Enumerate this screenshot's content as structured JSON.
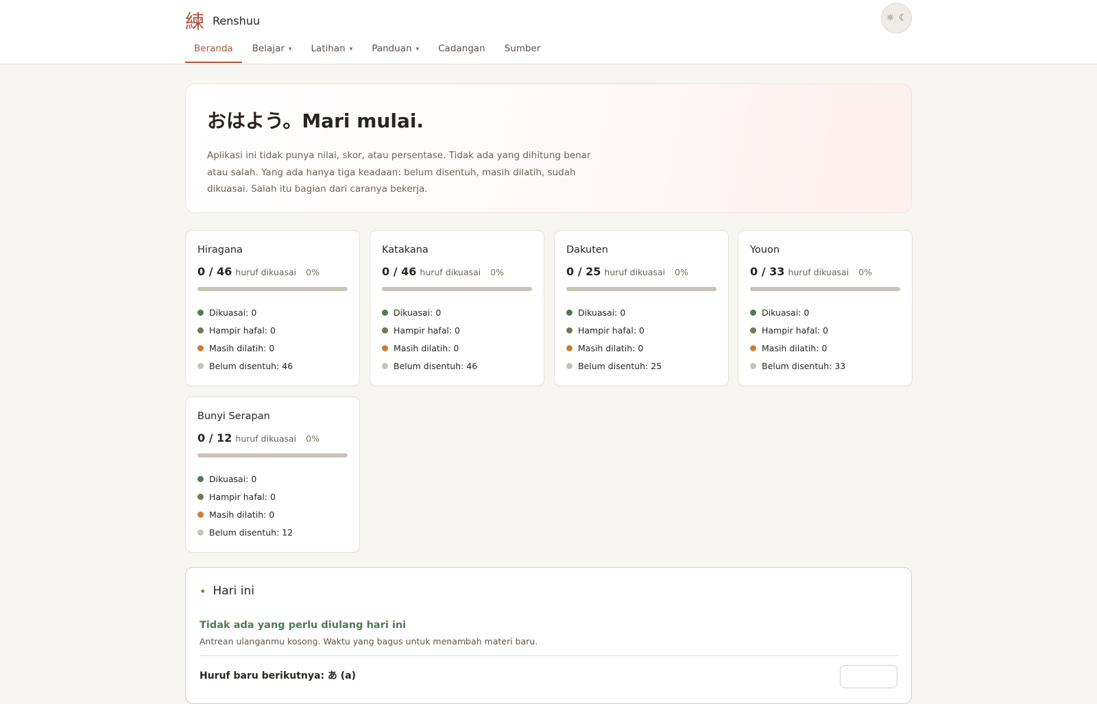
{
  "header": {
    "logo_kanji": "練",
    "app_name": "Renshuu",
    "theme_sun": "☼",
    "theme_moon": "☾",
    "nav": [
      {
        "label": "Beranda",
        "active": true
      },
      {
        "label": "Belajar",
        "caret": "▾"
      },
      {
        "label": "Latihan",
        "caret": "▾"
      },
      {
        "label": "Panduan",
        "caret": "▾"
      },
      {
        "label": "Cadangan"
      },
      {
        "label": "Sumber"
      }
    ]
  },
  "hero": {
    "title": "おはよう。Mari mulai.",
    "text": "Aplikasi ini tidak punya nilai, skor, atau persentase. Tidak ada yang dihitung benar atau salah. Yang ada hanya tiga keadaan: belum disentuh, masih dilatih, sudah dikuasai. Salah itu bagian dari caranya bekerja."
  },
  "cards": [
    {
      "title": "Hiragana",
      "count": "0 / 46",
      "count_label": "huruf dikuasai",
      "percent": "0%",
      "progress": 0,
      "mastered": "Dikuasai: 0",
      "almost": "Hampir hafal: 0",
      "practicing": "Masih dilatih: 0",
      "untouched": "Belum disentuh: 46"
    },
    {
      "title": "Katakana",
      "count": "0 / 46",
      "count_label": "huruf dikuasai",
      "percent": "0%",
      "progress": 0,
      "mastered": "Dikuasai: 0",
      "almost": "Hampir hafal: 0",
      "practicing": "Masih dilatih: 0",
      "untouched": "Belum disentuh: 46"
    },
    {
      "title": "Dakuten",
      "count": "0 / 25",
      "count_label": "huruf dikuasai",
      "percent": "0%",
      "progress": 0,
      "mastered": "Dikuasai: 0",
      "almost": "Hampir hafal: 0",
      "practicing": "Masih dilatih: 0",
      "untouched": "Belum disentuh: 25"
    },
    {
      "title": "Youon",
      "count": "0 / 33",
      "count_label": "huruf dikuasai",
      "percent": "0%",
      "progress": 0,
      "mastered": "Dikuasai: 0",
      "almost": "Hampir hafal: 0",
      "practicing": "Masih dilatih: 0",
      "untouched": "Belum disentuh: 33"
    },
    {
      "title": "Bunyi Serapan",
      "count": "0 / 12",
      "count_label": "huruf dikuasai",
      "percent": "0%",
      "progress": 0,
      "mastered": "Dikuasai: 0",
      "almost": "Hampir hafal: 0",
      "practicing": "Masih dilatih: 0",
      "untouched": "Belum disentuh: 12"
    }
  ],
  "today": {
    "bullet": "•",
    "title": "Hari ini",
    "message": "Tidak ada yang perlu diulang hari ini",
    "sub": "Antrean ulanganmu kosong. Waktu yang bagus untuk menambah materi baru.",
    "next_label": "Huruf baru berikutnya: あ (a)"
  },
  "colors": {
    "accent": "#a8553a",
    "mastered": "#4f7b4f",
    "almost": "#6d7a52",
    "practicing": "#cd7e35",
    "untouched": "#c9c2b8"
  }
}
